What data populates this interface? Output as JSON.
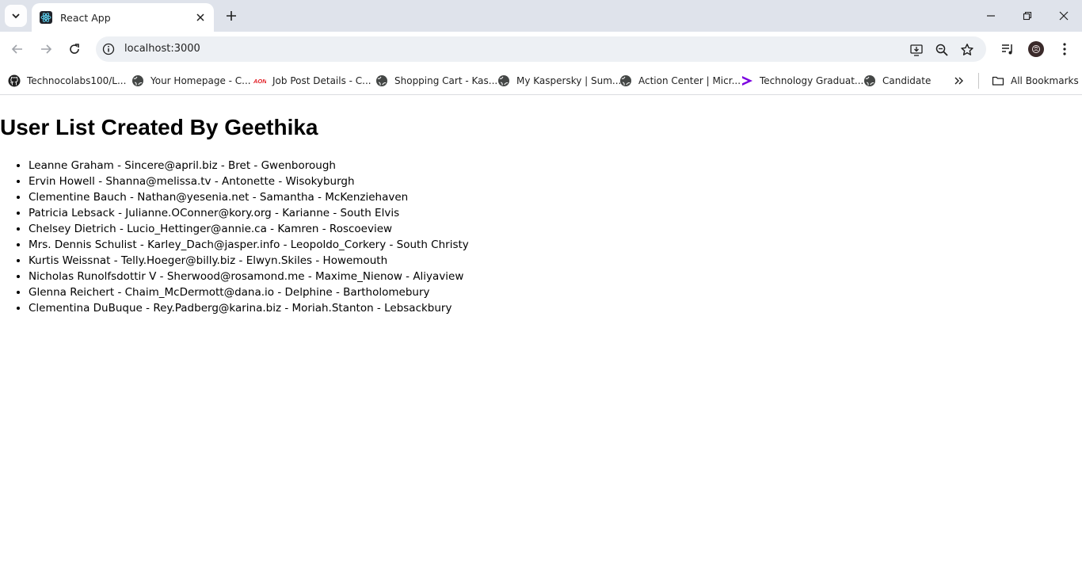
{
  "browser": {
    "tab": {
      "title": "React App"
    },
    "address": {
      "url": "localhost:3000"
    },
    "bookmarks": [
      {
        "label": "Technocolabs100/L...",
        "icon": "github-icon"
      },
      {
        "label": "Your Homepage - C...",
        "icon": "globe-icon"
      },
      {
        "label": "Job Post Details - C...",
        "icon": "aon-logo-icon"
      },
      {
        "label": "Shopping Cart - Kas...",
        "icon": "globe-icon"
      },
      {
        "label": "My Kaspersky | Sum...",
        "icon": "globe-icon"
      },
      {
        "label": "Action Center | Micr...",
        "icon": "globe-icon"
      },
      {
        "label": "Technology Graduat...",
        "icon": "accenture-icon"
      },
      {
        "label": "Candidate",
        "icon": "globe-icon"
      }
    ],
    "all_bookmarks_label": "All Bookmarks",
    "colors": {
      "tabstrip": "#dfe3eb",
      "omnibox": "#edf0f4",
      "accent_purple": "#7b00e0",
      "aon_red": "#e11b22"
    }
  },
  "page": {
    "title": "User List Created By Geethika",
    "users": [
      "Leanne Graham - Sincere@april.biz - Bret - Gwenborough",
      "Ervin Howell - Shanna@melissa.tv - Antonette - Wisokyburgh",
      "Clementine Bauch - Nathan@yesenia.net - Samantha - McKenziehaven",
      "Patricia Lebsack - Julianne.OConner@kory.org - Karianne - South Elvis",
      "Chelsey Dietrich - Lucio_Hettinger@annie.ca - Kamren - Roscoeview",
      "Mrs. Dennis Schulist - Karley_Dach@jasper.info - Leopoldo_Corkery - South Christy",
      "Kurtis Weissnat - Telly.Hoeger@billy.biz - Elwyn.Skiles - Howemouth",
      "Nicholas Runolfsdottir V - Sherwood@rosamond.me - Maxime_Nienow - Aliyaview",
      "Glenna Reichert - Chaim_McDermott@dana.io - Delphine - Bartholomebury",
      "Clementina DuBuque - Rey.Padberg@karina.biz - Moriah.Stanton - Lebsackbury"
    ]
  }
}
